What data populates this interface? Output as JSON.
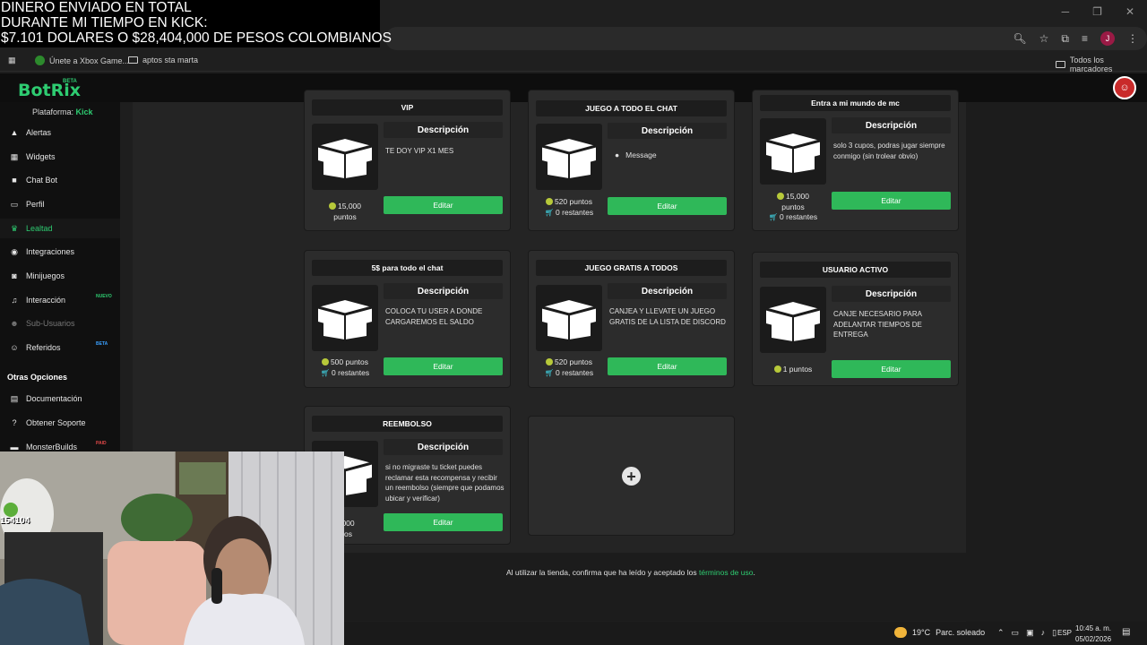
{
  "overlay": {
    "line1": "DINERO ENVIADO EN TOTAL",
    "line2": "DURANTE MI TIEMPO EN KICK:",
    "line3": "$7.101 DOLARES O $28,404,000 DE PESOS COLOMBIANOS"
  },
  "bookmarks": {
    "item1": "Únete a Xbox Game...",
    "item2": "aptos sta marta",
    "all": "Todos los marcadores"
  },
  "browser": {
    "avatar_initial": "J"
  },
  "app": {
    "logo": "BotRix",
    "logo_badge": "BETA",
    "platform_label": "Plataforma:",
    "platform_value": "Kick"
  },
  "sidebar": {
    "items": [
      {
        "label": "Alertas",
        "icon": "warning-icon"
      },
      {
        "label": "Widgets",
        "icon": "grid-icon"
      },
      {
        "label": "Chat Bot",
        "icon": "robot-icon"
      },
      {
        "label": "Perfil",
        "icon": "id-card-icon"
      },
      {
        "label": "Lealtad",
        "icon": "trophy-icon"
      },
      {
        "label": "Integraciones",
        "icon": "plug-icon"
      },
      {
        "label": "Minijuegos",
        "icon": "gamepad-icon"
      },
      {
        "label": "Interacción",
        "icon": "music-icon",
        "badge": "NUEVO"
      },
      {
        "label": "Sub-Usuarios",
        "icon": "users-icon"
      },
      {
        "label": "Referidos",
        "icon": "referral-icon",
        "badge": "BETA"
      }
    ],
    "section_title": "Otras Opciones",
    "other": [
      {
        "label": "Documentación",
        "icon": "book-icon"
      },
      {
        "label": "Obtener Soporte",
        "icon": "help-icon"
      },
      {
        "label": "MonsterBuilds",
        "icon": "monitor-icon",
        "badge": "PAID"
      }
    ]
  },
  "rewards": [
    {
      "title": "VIP",
      "desc_header": "Descripción",
      "desc": "TE DOY VIP X1 MES",
      "points": "15,000",
      "unit": "puntos",
      "edit": "Editar"
    },
    {
      "title": "JUEGO A TODO EL CHAT",
      "desc_header": "Descripción",
      "message": "Message",
      "points": "520 puntos",
      "remaining": "0 restantes",
      "edit": "Editar"
    },
    {
      "title": "Entra a mi mundo de mc",
      "desc_header": "Descripción",
      "desc": "solo 3 cupos, podras jugar siempre conmigo (sin trolear obvio)",
      "points": "15,000",
      "unit": "puntos",
      "remaining": "0 restantes",
      "edit": "Editar"
    },
    {
      "title": "5$ para todo el chat",
      "desc_header": "Descripción",
      "desc": "COLOCA TU USER A DONDE CARGAREMOS EL SALDO",
      "points": "500 puntos",
      "remaining": "0 restantes",
      "edit": "Editar"
    },
    {
      "title": "JUEGO GRATIS A TODOS",
      "desc_header": "Descripción",
      "desc": "CANJEA Y LLEVATE UN JUEGO GRATIS DE LA LISTA DE DISCORD",
      "points": "520 puntos",
      "remaining": "0 restantes",
      "edit": "Editar"
    },
    {
      "title": "USUARIO ACTIVO",
      "desc_header": "Descripción",
      "desc": "CANJE NECESARIO PARA ADELANTAR TIEMPOS DE ENTREGA",
      "points": "1 puntos",
      "edit": "Editar"
    },
    {
      "title": "REEMBOLSO",
      "desc_header": "Descripción",
      "desc": "si no migraste tu ticket puedes reclamar esta recompensa y recibir un reembolso (siempre que podamos ubicar y verificar)",
      "points": "0,000",
      "unit": "ntos",
      "edit": "Editar"
    }
  ],
  "footer": {
    "text": "Al utilizar la tienda, confirma que ha leído y aceptado los ",
    "link": "términos de uso",
    "tail": "."
  },
  "webcam": {
    "counter": "154104"
  },
  "taskbar": {
    "temp": "19°C",
    "weather": "Parc. soleado",
    "lang": "ESP",
    "time": "10:45 a. m.",
    "date": "05/02/2026"
  }
}
